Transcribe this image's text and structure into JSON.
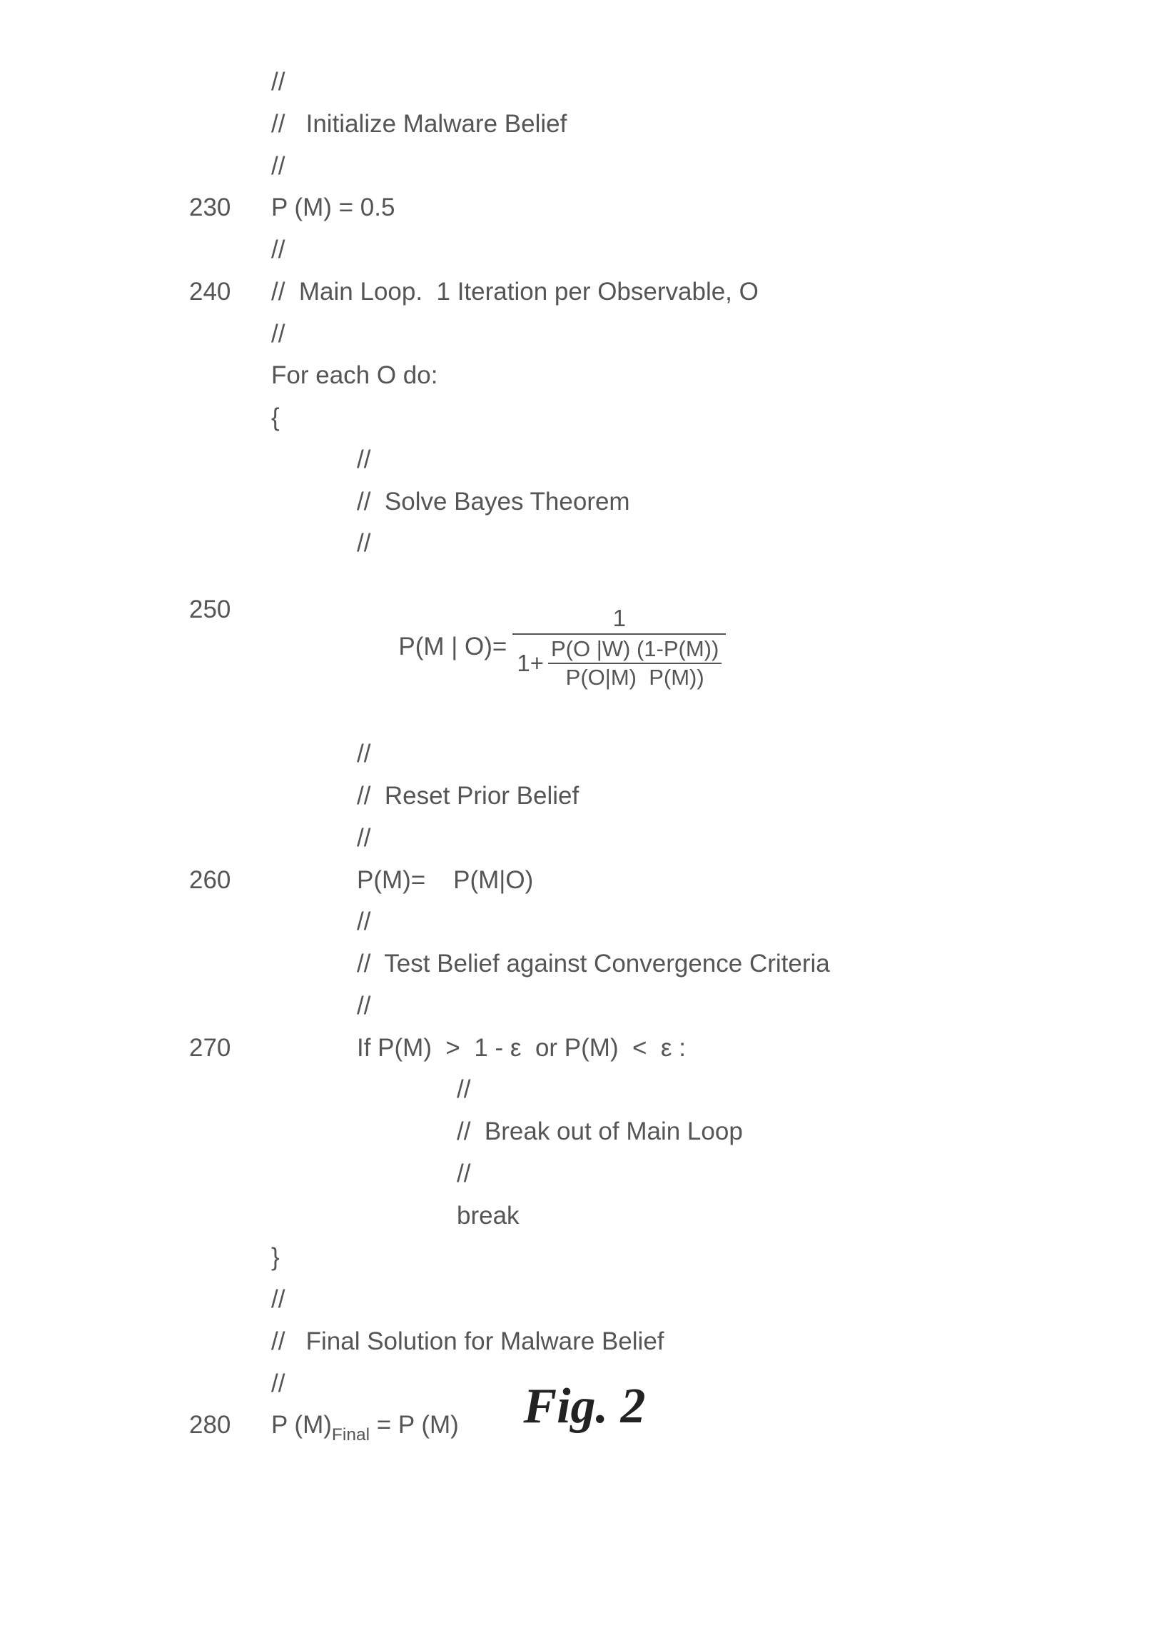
{
  "lines": {
    "c1": "//",
    "c2": "//   Initialize Malware Belief",
    "c3": "//",
    "l230": "P (M) = 0.5",
    "c4": "//",
    "l240": "//  Main Loop.  1 Iteration per Observable, O",
    "c5": "//",
    "foreach": "For each O do:",
    "obrace": "{",
    "c6": "//",
    "c7": "//  Solve Bayes Theorem",
    "c8": "//",
    "bayes_lhs": "P(M | O)=",
    "bayes_num": "1",
    "bayes_den_prefix": "1+",
    "bayes_inner_num": "P(O |W) (1-P(M))",
    "bayes_inner_den": "P(O|M)  P(M))",
    "c9": "//",
    "c10": "//  Reset Prior Belief",
    "c11": "//",
    "l260_a": "P(M)=",
    "l260_b": "P(M|O)",
    "c12": "//",
    "c13": "//  Test Belief against Convergence Criteria",
    "c14": "//",
    "l270": "If P(M)  >  1 - ε  or P(M)  <  ε :",
    "c15": "//",
    "c16": "//  Break out of Main Loop",
    "c17": "//",
    "brk": "break",
    "cbrace": "}",
    "c18": "//",
    "c19": "//   Final Solution for Malware Belief",
    "c20": "//",
    "l280_a": "P (M)",
    "l280_sub": "Final",
    "l280_b": " = P (M)"
  },
  "linenos": {
    "n230": "230",
    "n240": "240",
    "n250": "250",
    "n260": "260",
    "n270": "270",
    "n280": "280"
  },
  "caption": "Fig. 2"
}
